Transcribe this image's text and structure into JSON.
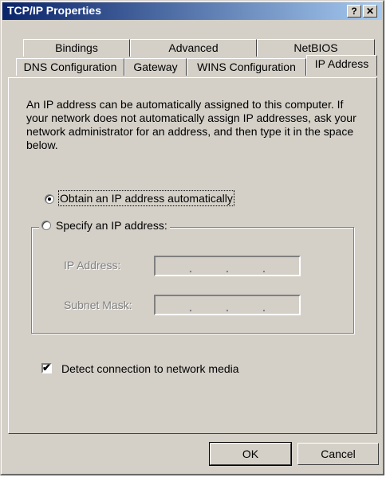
{
  "window": {
    "title": "TCP/IP Properties",
    "help_label": "?",
    "close_label": "✕"
  },
  "tabs_back": [
    {
      "label": "Bindings"
    },
    {
      "label": "Advanced"
    },
    {
      "label": "NetBIOS"
    }
  ],
  "tabs_front": [
    {
      "label": "DNS Configuration"
    },
    {
      "label": "Gateway"
    },
    {
      "label": "WINS Configuration"
    },
    {
      "label": "IP Address",
      "active": true
    }
  ],
  "description": "An IP address can be automatically assigned to this computer. If your network does not automatically assign IP addresses, ask your network administrator for an address, and then type it in the space below.",
  "options": {
    "obtain_auto": {
      "label": "Obtain an IP address automatically",
      "selected": true
    },
    "specify": {
      "label": "Specify an IP address:",
      "selected": false
    }
  },
  "fields": {
    "ip_address": {
      "label": "IP Address:",
      "dots": "..."
    },
    "subnet_mask": {
      "label": "Subnet Mask:",
      "dots": "..."
    }
  },
  "detect": {
    "label": "Detect connection to network media",
    "checked": true
  },
  "buttons": {
    "ok": "OK",
    "cancel": "Cancel"
  }
}
